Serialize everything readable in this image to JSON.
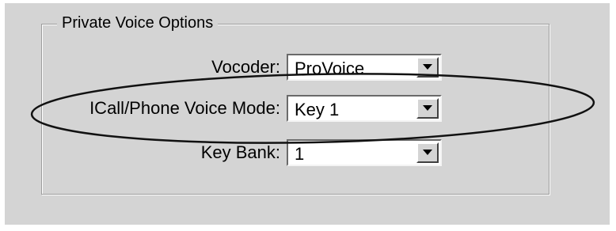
{
  "group": {
    "title": "Private Voice Options"
  },
  "fields": [
    {
      "label": "Vocoder:",
      "value": "ProVoice"
    },
    {
      "label": "ICall/Phone Voice Mode:",
      "value": "Key 1"
    },
    {
      "label": "Key Bank:",
      "value": "1"
    }
  ],
  "icons": {
    "dropdown": "chevron-down-icon"
  }
}
